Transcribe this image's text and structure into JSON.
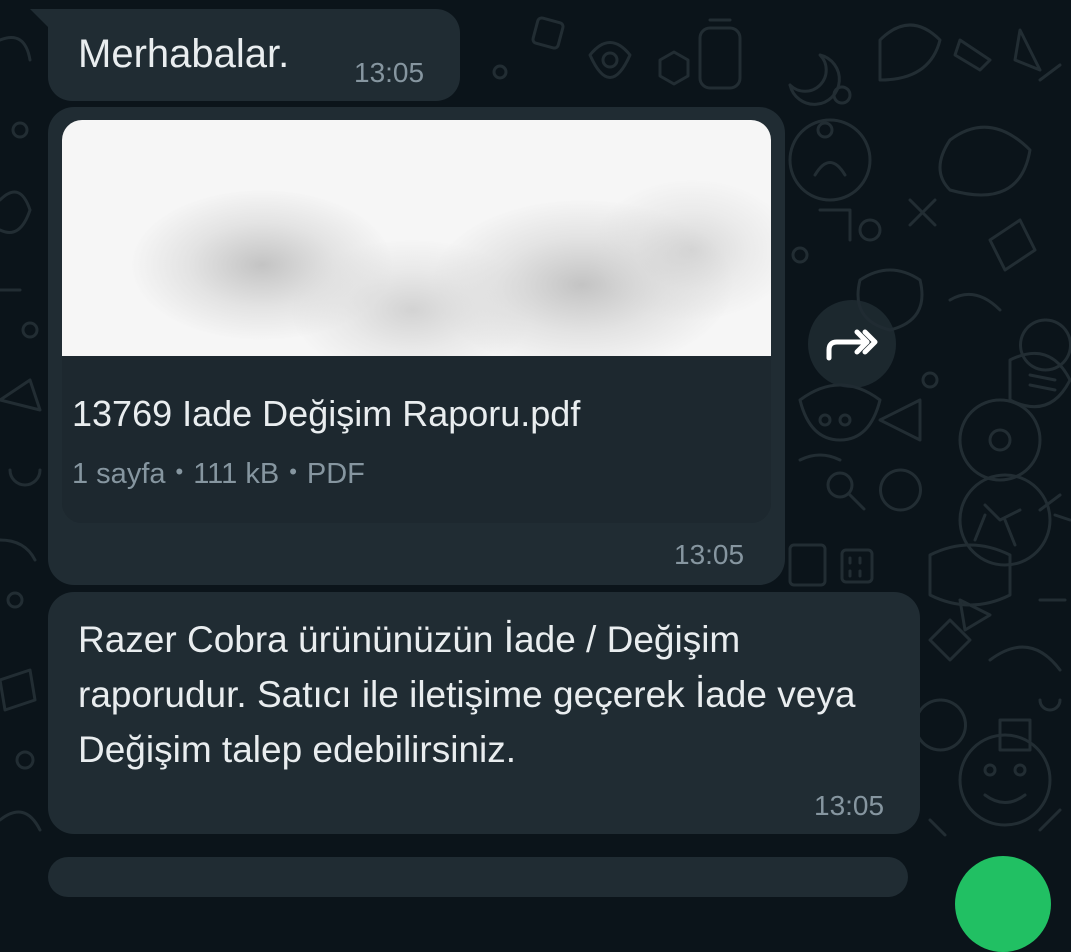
{
  "messages": [
    {
      "text": "Merhabalar.",
      "time": "13:05"
    },
    {
      "document": {
        "name": "13769 Iade Değişim Raporu.pdf",
        "pages": "1 sayfa",
        "size": "111 kB",
        "type": "PDF",
        "separator": "•"
      },
      "time": "13:05"
    },
    {
      "text": "Razer Cobra ürününüzün İade / Değişim raporudur. Satıcı ile iletişime geçerek İade veya Değişim talep edebilirsiniz.",
      "time": "13:05"
    }
  ],
  "icons": {
    "forward": "forward-icon"
  },
  "colors": {
    "background": "#0b141a",
    "bubble_incoming": "#202c33",
    "text_primary": "#e9edef",
    "text_secondary": "#8696a0",
    "fab": "#21c063"
  }
}
